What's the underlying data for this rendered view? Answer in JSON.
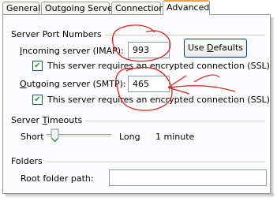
{
  "tabs": [
    {
      "label": "General"
    },
    {
      "label": "Outgoing Server"
    },
    {
      "label": "Connection"
    },
    {
      "label": "Advanced",
      "active": true
    }
  ],
  "server_ports": {
    "title": "Server Port Numbers",
    "incoming_label_pre": "",
    "incoming_label_u": "I",
    "incoming_label_post": "ncoming server (IMAP):",
    "incoming_value": "993",
    "use_defaults_pre": "Use ",
    "use_defaults_u": "D",
    "use_defaults_post": "efaults",
    "ssl_incoming_label": "This server requires an encrypted connection (SSL)",
    "ssl_incoming_checked": true,
    "outgoing_label_pre": "",
    "outgoing_label_u": "O",
    "outgoing_label_post": "utgoing server (SMTP):",
    "outgoing_value": "465",
    "ssl_outgoing_label": "This server requires an encrypted connection (SSL)",
    "ssl_outgoing_checked": true
  },
  "timeouts": {
    "title_pre": "Server ",
    "title_u": "T",
    "title_post": "imeouts",
    "short_label": "Short",
    "long_label": "Long",
    "value": "1 minute",
    "slider_fraction": 0.0
  },
  "folders": {
    "title": "Folders",
    "root_label": "Root folder path:",
    "root_value": ""
  },
  "annotation_color": "#e0201b"
}
